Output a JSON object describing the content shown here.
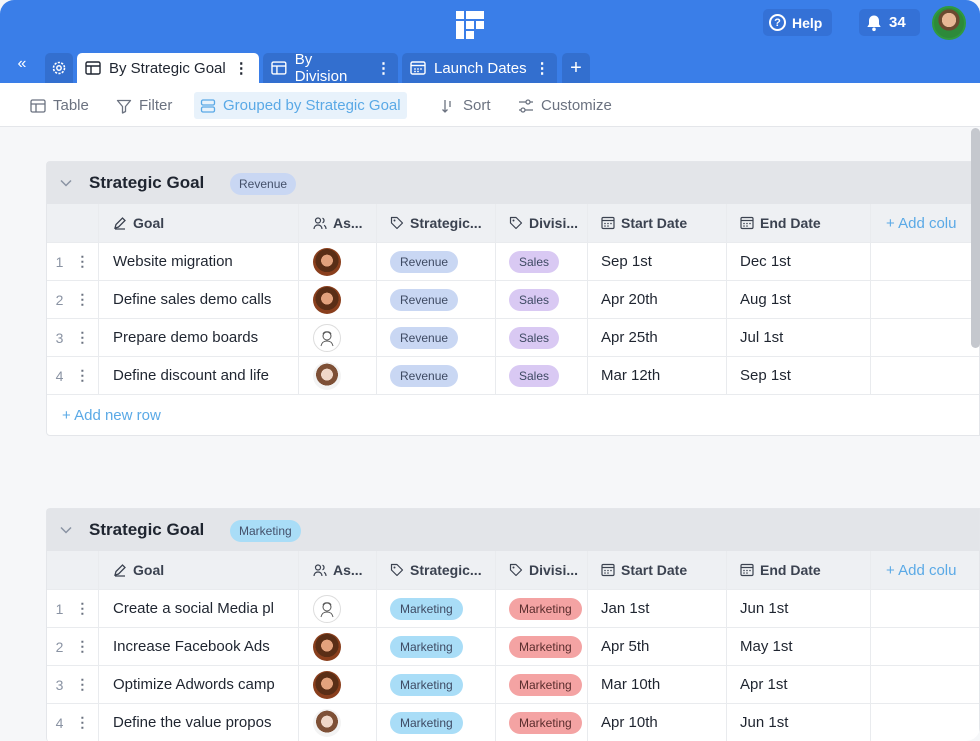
{
  "header": {
    "help_label": "Help",
    "notifications_count": "34"
  },
  "tabs": [
    {
      "label": "By Strategic Goal",
      "icon": "table-icon"
    },
    {
      "label": "By Division",
      "icon": "table-icon"
    },
    {
      "label": "Launch Dates",
      "icon": "calendar-icon"
    }
  ],
  "toolbar": {
    "table_label": "Table",
    "filter_label": "Filter",
    "grouped_label": "Grouped by Strategic Goal",
    "sort_label": "Sort",
    "customize_label": "Customize"
  },
  "columns": {
    "goal": "Goal",
    "assignee": "As...",
    "strategic": "Strategic...",
    "division": "Divisi...",
    "start": "Start Date",
    "end": "End Date",
    "add": "+ Add colu"
  },
  "add_row_label": "+ Add new row",
  "groups": [
    {
      "title": "Strategic Goal",
      "badge": "Revenue",
      "rows": [
        {
          "num": "1",
          "goal": "Website migration",
          "strategic": "Revenue",
          "division": "Sales",
          "start": "Sep 1st",
          "end": "Dec 1st"
        },
        {
          "num": "2",
          "goal": "Define sales demo calls",
          "strategic": "Revenue",
          "division": "Sales",
          "start": "Apr 20th",
          "end": "Aug 1st"
        },
        {
          "num": "3",
          "goal": "Prepare demo boards",
          "strategic": "Revenue",
          "division": "Sales",
          "start": "Apr 25th",
          "end": "Jul 1st"
        },
        {
          "num": "4",
          "goal": "Define discount and life",
          "strategic": "Revenue",
          "division": "Sales",
          "start": "Mar 12th",
          "end": "Sep 1st"
        }
      ]
    },
    {
      "title": "Strategic Goal",
      "badge": "Marketing",
      "rows": [
        {
          "num": "1",
          "goal": "Create a social Media pl",
          "strategic": "Marketing",
          "division": "Marketing",
          "start": "Jan 1st",
          "end": "Jun 1st"
        },
        {
          "num": "2",
          "goal": "Increase Facebook Ads",
          "strategic": "Marketing",
          "division": "Marketing",
          "start": "Apr 5th",
          "end": "May 1st"
        },
        {
          "num": "3",
          "goal": "Optimize Adwords camp",
          "strategic": "Marketing",
          "division": "Marketing",
          "start": "Mar 10th",
          "end": "Apr 1st"
        },
        {
          "num": "4",
          "goal": "Define the value propos",
          "strategic": "Marketing",
          "division": "Marketing",
          "start": "Apr 10th",
          "end": "Jun 1st"
        }
      ]
    }
  ],
  "colors": {
    "brand_blue": "#3a7ee8",
    "accent_light_blue": "#5aa9e6",
    "revenue_pill": "#c9d7f3",
    "sales_pill": "#d9c9f3",
    "marketing_pill_blue": "#a9ddf7",
    "marketing_pill_red": "#f4a3a3"
  }
}
